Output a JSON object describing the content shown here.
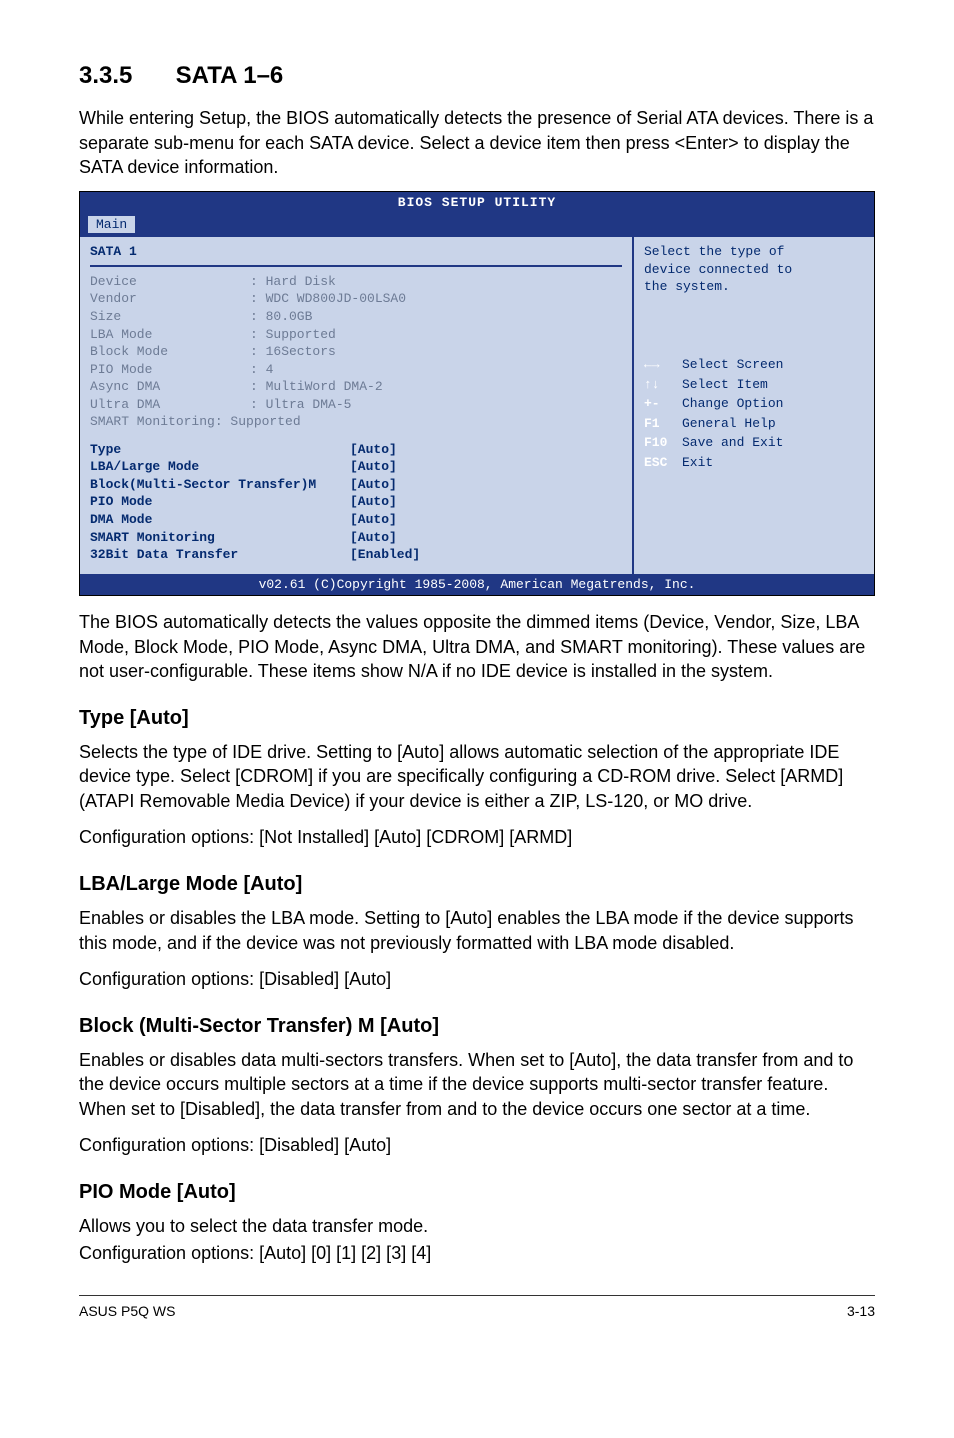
{
  "section": {
    "number": "3.3.5",
    "title": "SATA 1–6"
  },
  "intro": "While entering Setup, the BIOS automatically detects the presence of Serial ATA devices. There is a separate sub-menu for each SATA device. Select a device item then press <Enter> to display the SATA device information.",
  "bios": {
    "header": "BIOS SETUP UTILITY",
    "tab": "Main",
    "panel_title": "SATA 1",
    "info": [
      {
        "label": "Device",
        "value": ": Hard Disk"
      },
      {
        "label": "Vendor",
        "value": ": WDC WD800JD-00LSA0"
      },
      {
        "label": "Size",
        "value": ": 80.0GB"
      },
      {
        "label": "LBA Mode",
        "value": ": Supported"
      },
      {
        "label": "Block Mode",
        "value": ": 16Sectors"
      },
      {
        "label": "PIO Mode",
        "value": ": 4"
      },
      {
        "label": "Async DMA",
        "value": ": MultiWord DMA-2"
      },
      {
        "label": "Ultra DMA",
        "value": ": Ultra DMA-5"
      },
      {
        "label": "SMART Monitoring",
        "value": ": Supported",
        "single": true
      }
    ],
    "options": [
      {
        "label": "Type",
        "value": "[Auto]"
      },
      {
        "label": "LBA/Large Mode",
        "value": "[Auto]"
      },
      {
        "label": "Block(Multi-Sector Transfer)M",
        "value": "[Auto]"
      },
      {
        "label": "PIO Mode",
        "value": "[Auto]"
      },
      {
        "label": "DMA Mode",
        "value": "[Auto]"
      },
      {
        "label": "SMART Monitoring",
        "value": "[Auto]"
      },
      {
        "label": "32Bit Data Transfer",
        "value": "[Enabled]"
      }
    ],
    "help_top1": "Select the type of",
    "help_top2": "device connected to",
    "help_top3": "the system.",
    "nav": [
      {
        "key": "←→",
        "text": "Select Screen"
      },
      {
        "key": "↑↓",
        "text": "Select Item"
      },
      {
        "key": "+-",
        "text": "Change Option"
      },
      {
        "key": "F1",
        "text": "General Help"
      },
      {
        "key": "F10",
        "text": "Save and Exit"
      },
      {
        "key": "ESC",
        "text": "Exit"
      }
    ],
    "copyright": "v02.61 (C)Copyright 1985-2008, American Megatrends, Inc."
  },
  "after_bios": "The BIOS automatically detects the values opposite the dimmed items (Device, Vendor, Size, LBA Mode, Block Mode, PIO Mode, Async DMA, Ultra DMA, and SMART monitoring). These values are not user-configurable. These items show N/A if no IDE device is installed in the system.",
  "type": {
    "heading": "Type [Auto]",
    "p1": "Selects the type of IDE drive. Setting to [Auto] allows automatic selection of the appropriate IDE device type. Select [CDROM] if you are specifically configuring a CD-ROM drive. Select [ARMD] (ATAPI Removable Media Device) if your device is either a ZIP, LS-120, or MO drive.",
    "p2": "Configuration options: [Not Installed] [Auto] [CDROM] [ARMD]"
  },
  "lba": {
    "heading": "LBA/Large Mode [Auto]",
    "p1": "Enables or disables the LBA mode. Setting to [Auto] enables the LBA mode if the device supports this mode, and if the device was not previously formatted with LBA mode disabled.",
    "p2": "Configuration options: [Disabled] [Auto]"
  },
  "block": {
    "heading": "Block (Multi-Sector Transfer) M [Auto]",
    "p1": "Enables or disables data multi-sectors transfers. When set to [Auto], the data transfer from and to the device occurs multiple sectors at a time if the device supports multi-sector transfer feature. When set to [Disabled], the data transfer from and to the device occurs one sector at a time.",
    "p2": "Configuration options: [Disabled] [Auto]"
  },
  "pio": {
    "heading": "PIO Mode [Auto]",
    "p1": "Allows you to select the data transfer mode.",
    "p2": "Configuration options: [Auto] [0] [1] [2] [3] [4]"
  },
  "footer": {
    "left": "ASUS P5Q WS",
    "right": "3-13"
  }
}
